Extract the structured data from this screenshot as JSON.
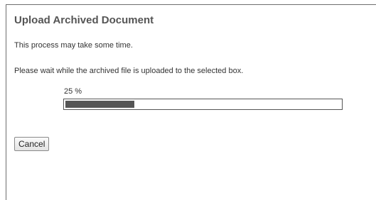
{
  "dialog": {
    "title": "Upload Archived Document",
    "message_time": "This process may take some time.",
    "message_wait": "Please wait while the archived file is uploaded to the selected box."
  },
  "progress": {
    "label": "25 %",
    "percent": 25
  },
  "buttons": {
    "cancel_label": "Cancel"
  }
}
